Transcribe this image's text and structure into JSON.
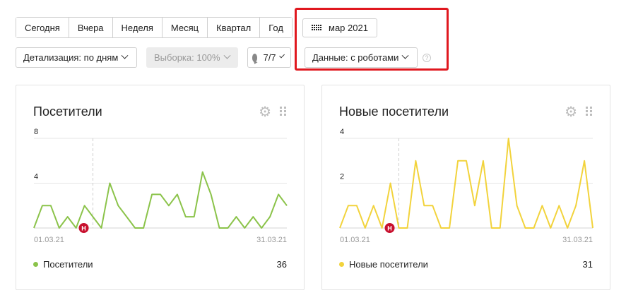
{
  "period": {
    "buttons": [
      "Сегодня",
      "Вчера",
      "Неделя",
      "Месяц",
      "Квартал",
      "Год"
    ],
    "date_label": "мар 2021"
  },
  "filters": {
    "detail": "Детализация: по дням",
    "sample": "Выборка: 100%",
    "segments": "7/7",
    "data": "Данные: с роботами",
    "help": "?"
  },
  "widgets": [
    {
      "title": "Посетители",
      "legend": "Посетители",
      "total": "36",
      "color": "#8bc34a",
      "start_label": "01.03.21",
      "end_label": "31.03.21"
    },
    {
      "title": "Новые посетители",
      "legend": "Новые посетители",
      "total": "31",
      "color": "#f2d33c",
      "start_label": "01.03.21",
      "end_label": "31.03.21"
    }
  ],
  "annotation": {
    "label": "Н",
    "color": "#c8102e"
  },
  "chart_data": [
    {
      "type": "line",
      "series": [
        {
          "name": "Посетители",
          "values": [
            0,
            2,
            2,
            0,
            1,
            0,
            2,
            1,
            0,
            4,
            2,
            1,
            0,
            0,
            3,
            3,
            2,
            3,
            1,
            1,
            5,
            3,
            0,
            0,
            1,
            0,
            1,
            0,
            1,
            3,
            2
          ]
        }
      ],
      "x": [
        "01.03.21",
        "31.03.21"
      ],
      "yticks": [
        4,
        8
      ],
      "ylim": [
        0,
        8
      ],
      "annotation_day": 7
    },
    {
      "type": "line",
      "series": [
        {
          "name": "Новые посетители",
          "values": [
            0,
            1,
            1,
            0,
            1,
            0,
            2,
            0,
            0,
            3,
            1,
            1,
            0,
            0,
            3,
            3,
            1,
            3,
            0,
            0,
            4,
            1,
            0,
            0,
            1,
            0,
            1,
            0,
            1,
            3,
            0
          ]
        }
      ],
      "x": [
        "01.03.21",
        "31.03.21"
      ],
      "yticks": [
        2,
        4
      ],
      "ylim": [
        0,
        4
      ],
      "annotation_day": 7
    }
  ]
}
